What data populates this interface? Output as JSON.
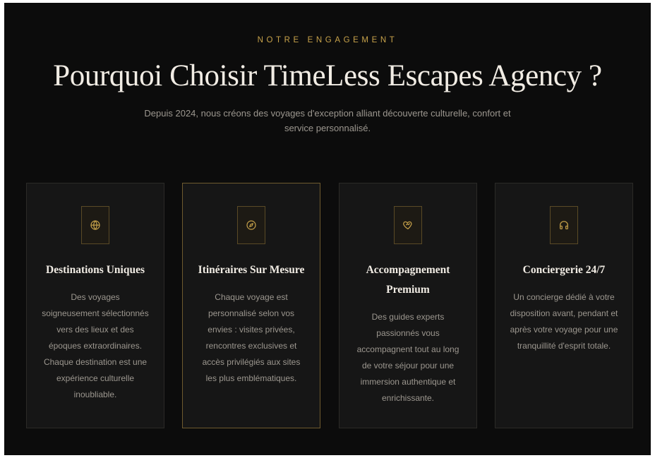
{
  "section": {
    "eyebrow": "NOTRE ENGAGEMENT",
    "title": "Pourquoi Choisir TimeLess Escapes Agency ?",
    "subtitle": "Depuis 2024, nous créons des voyages d'exception alliant découverte culturelle, confort et service personnalisé."
  },
  "cards": [
    {
      "icon": "globe-icon",
      "title": "Destinations Uniques",
      "text": "Des voyages soigneusement sélectionnés vers des lieux et des époques extraordinaires. Chaque destination est une expérience culturelle inoubliable."
    },
    {
      "icon": "compass-icon",
      "title": "Itinéraires Sur Mesure",
      "text": "Chaque voyage est personnalisé selon vos envies : visites privées, rencontres exclusives et accès privilégiés aux sites les plus emblématiques."
    },
    {
      "icon": "heart-handshake-icon",
      "title": "Accompagnement Premium",
      "text": "Des guides experts passionnés vous accompagnent tout au long de votre séjour pour une immersion authentique et enrichissante."
    },
    {
      "icon": "headphones-icon",
      "title": "Conciergerie 24/7",
      "text": "Un concierge dédié à votre disposition avant, pendant et après votre voyage pour une tranquillité d'esprit totale."
    }
  ],
  "colors": {
    "accent": "#c7a24a",
    "background": "#0c0c0c",
    "card": "#161616",
    "heading": "#f1ece4",
    "body_text": "#9c978f"
  }
}
